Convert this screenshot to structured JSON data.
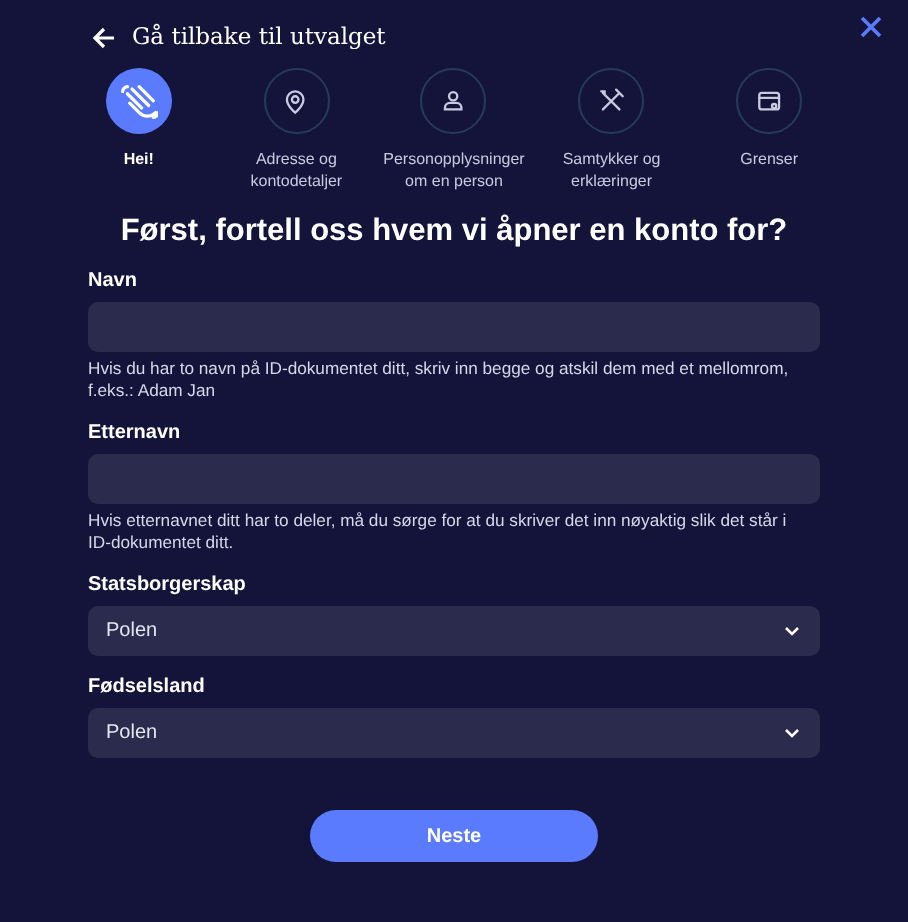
{
  "back_link": {
    "label": "Gå tilbake til utvalget"
  },
  "steps": [
    {
      "kind": "wave",
      "label": "Hei!",
      "selected": true
    },
    {
      "kind": "pin",
      "label": "Adresse og kontodetaljer",
      "selected": false
    },
    {
      "kind": "person",
      "label": "Personopplysninger om en person",
      "selected": false
    },
    {
      "kind": "tools",
      "label": "Samtykker og erklæringer",
      "selected": false
    },
    {
      "kind": "card",
      "label": "Grenser",
      "selected": false
    }
  ],
  "heading": "Først, fortell oss hvem vi åpner en konto for?",
  "fields": [
    {
      "kind": "text",
      "label": "Navn",
      "hint": "Hvis du har to navn på ID-dokumentet ditt, skriv inn begge og atskil dem med et mellomrom, f.eks.: Adam Jan"
    },
    {
      "kind": "text",
      "label": "Etternavn",
      "hint": "Hvis etternavnet ditt har to deler, må du sørge for at du skriver det inn nøyaktig slik det står i ID-dokumentet ditt."
    },
    {
      "kind": "select",
      "label": "Statsborgerskap",
      "value": "Polen"
    },
    {
      "kind": "select",
      "label": "Fødselsland",
      "value": "Polen"
    }
  ],
  "next_button": "Neste"
}
